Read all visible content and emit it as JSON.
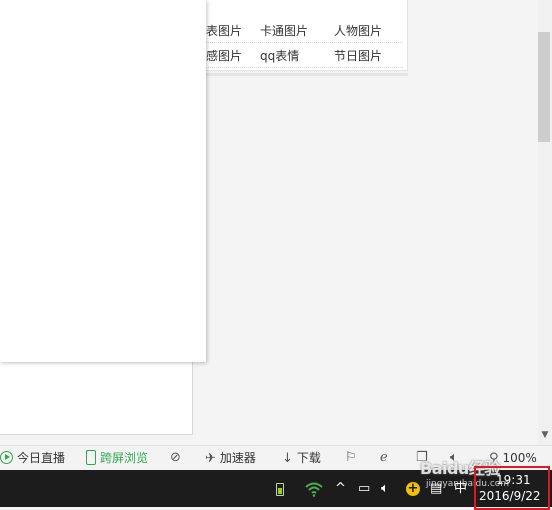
{
  "page_links": {
    "row1": [
      "表图片",
      "卡通图片",
      "人物图片"
    ],
    "row2": [
      "感图片",
      "qq表情",
      "节日图片"
    ]
  },
  "statusbar": {
    "today_live": "今日直播",
    "cross_screen": "跨屏浏览",
    "accelerator": "加速器",
    "download": "下载",
    "zoom": "100%"
  },
  "taskbar": {
    "ime_label": "中",
    "time": "19:31",
    "date": "2016/9/22"
  },
  "watermark": {
    "brand": "Baidu经验",
    "url": "jingyan.baidu.com"
  },
  "colors": {
    "accent_green": "#2fa84f",
    "highlight_red": "#e0191e"
  }
}
